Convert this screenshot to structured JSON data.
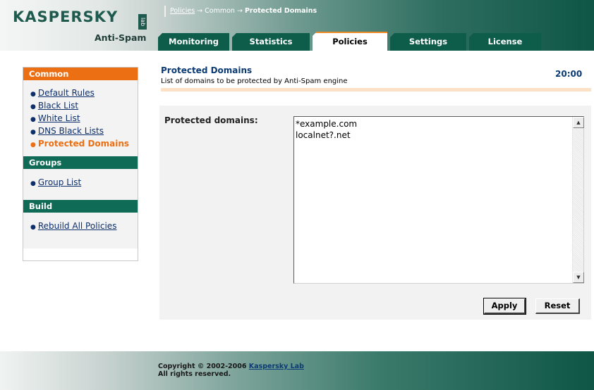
{
  "brand": {
    "logo_text": "KASPERSKY",
    "logo_lab": "lab",
    "product": "Anti-Spam"
  },
  "breadcrumb": {
    "part1": "Policies",
    "sep": " → ",
    "part2": "Common",
    "part3": "Protected Domains"
  },
  "tabs": [
    {
      "label": "Monitoring"
    },
    {
      "label": "Statistics"
    },
    {
      "label": "Policies"
    },
    {
      "label": "Settings"
    },
    {
      "label": "License"
    }
  ],
  "sidebar": {
    "sections": [
      {
        "title": "Common",
        "items": [
          "Default Rules",
          "Black List",
          "White List",
          "DNS Black Lists",
          "Protected Domains"
        ]
      },
      {
        "title": "Groups",
        "items": [
          "Group List"
        ]
      },
      {
        "title": "Build",
        "items": [
          "Rebuild All Policies"
        ]
      }
    ],
    "current_item": "Protected Domains"
  },
  "main": {
    "title": "Protected Domains",
    "subtitle": "List of domains to be protected by Anti-Spam engine",
    "time": "20:00",
    "field_label": "Protected domains:",
    "domains_text": "*example.com\nlocalnet?.net",
    "apply_label": "Apply",
    "reset_label": "Reset"
  },
  "footer": {
    "copyright": "Copyright © 2002-2006 ",
    "company": "Kaspersky Lab",
    "rights": "All rights reserved."
  },
  "colors": {
    "orange": "#ec6f14",
    "green": "#0f6b55",
    "title_blue": "#0b3b74"
  }
}
